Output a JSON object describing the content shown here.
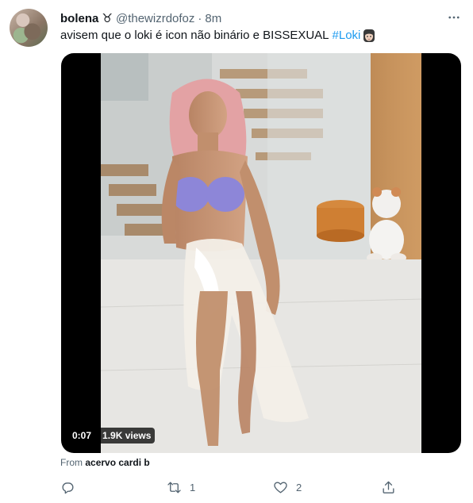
{
  "tweet": {
    "author_name": "bolena ♉",
    "author_handle": "@thewizrdofoz",
    "separator": "·",
    "time": "8m",
    "text": "avisem que o loki é icon não binário e BISSEXUAL",
    "hashtag": "#Loki",
    "emoji_icon": "loki-face-emoji-icon"
  },
  "media": {
    "duration": "0:07",
    "views": "1.9K views"
  },
  "source": {
    "prefix": "From",
    "name": "acervo cardi b"
  },
  "actions": {
    "reply_count": "",
    "retweet_count": "1",
    "like_count": "2"
  },
  "colors": {
    "link": "#1d9bf0",
    "secondary_text": "#536471"
  }
}
